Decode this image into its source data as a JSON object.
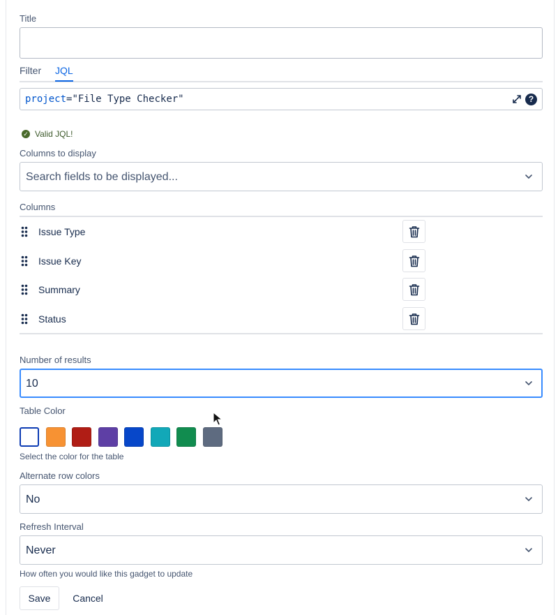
{
  "title_field": {
    "label": "Title",
    "value": "",
    "placeholder": ""
  },
  "tabs": [
    {
      "label": "Filter",
      "active": false
    },
    {
      "label": "JQL",
      "active": true
    }
  ],
  "jql": {
    "key": "project",
    "operator": "=",
    "value": "\"File Type Checker\"",
    "expand_icon": "expand-diagonal-icon",
    "help_icon": "question-circle-icon"
  },
  "validation": {
    "message": "Valid JQL!",
    "icon": "check-circle-icon",
    "color": "#4a6a2b"
  },
  "columns_to_display": {
    "label": "Columns to display",
    "placeholder": "Search fields to be displayed..."
  },
  "columns": {
    "label": "Columns",
    "items": [
      {
        "name": "Issue Type"
      },
      {
        "name": "Issue Key"
      },
      {
        "name": "Summary"
      },
      {
        "name": "Status"
      }
    ],
    "drag_icon": "drag-handle-icon",
    "delete_icon": "trash-icon"
  },
  "number_of_results": {
    "label": "Number of results",
    "value": "10"
  },
  "table_color": {
    "label": "Table Color",
    "hint": "Select the color for the table",
    "swatches": [
      "#ffffff",
      "#f79233",
      "#b01d15",
      "#5e3fa5",
      "#0747c9",
      "#12a8b8",
      "#118c4f",
      "#5e6b80"
    ],
    "selected_index": 0
  },
  "alternate_row_colors": {
    "label": "Alternate row colors",
    "value": "No"
  },
  "refresh_interval": {
    "label": "Refresh Interval",
    "value": "Never",
    "hint": "How often you would like this gadget to update"
  },
  "actions": {
    "save_label": "Save",
    "cancel_label": "Cancel"
  },
  "colors": {
    "accent": "#0c66e4",
    "text": "#172b4d",
    "subtle_text": "#44546f",
    "border": "#c1c7d0"
  }
}
